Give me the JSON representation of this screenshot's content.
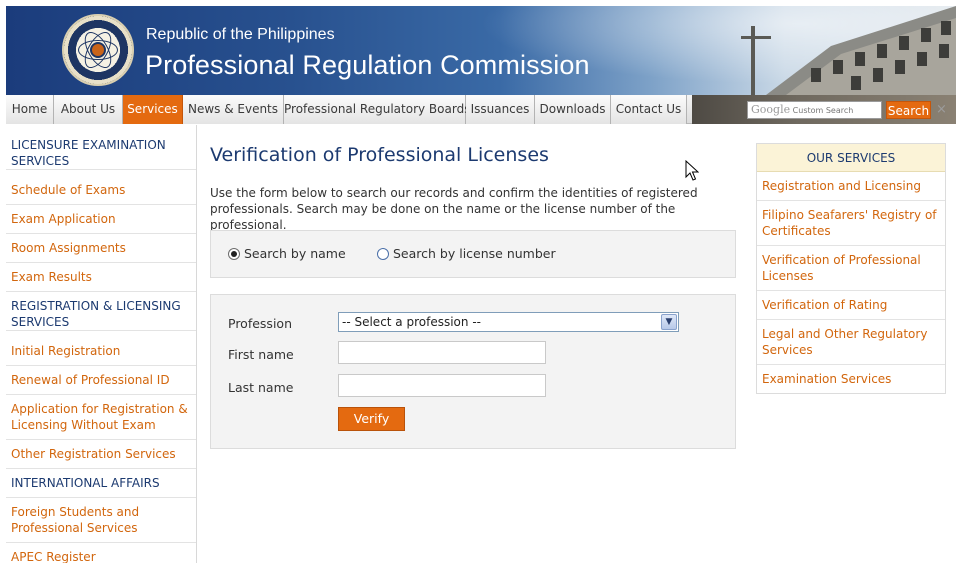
{
  "header": {
    "subtitle": "Republic of the Philippines",
    "title": "Professional Regulation Commission"
  },
  "nav": {
    "tabs": [
      {
        "label": "Home"
      },
      {
        "label": "About Us"
      },
      {
        "label": "Services",
        "active": true
      },
      {
        "label": "News & Events"
      },
      {
        "label": "Professional Regulatory Boards"
      },
      {
        "label": "Issuances"
      },
      {
        "label": "Downloads"
      },
      {
        "label": "Contact Us"
      }
    ],
    "search": {
      "google_label": "Google",
      "placeholder": "Custom Search",
      "button_label": "Search",
      "close_glyph": "×"
    }
  },
  "sidebar": {
    "items": [
      {
        "label": "LICENSURE EXAMINATION SERVICES",
        "type": "head"
      },
      {
        "label": "Schedule of Exams",
        "type": "link"
      },
      {
        "label": "Exam Application",
        "type": "link"
      },
      {
        "label": "Room Assignments",
        "type": "link"
      },
      {
        "label": "Exam Results",
        "type": "link"
      },
      {
        "label": "REGISTRATION & LICENSING SERVICES",
        "type": "head"
      },
      {
        "label": "Initial Registration",
        "type": "link"
      },
      {
        "label": "Renewal of Professional ID",
        "type": "link"
      },
      {
        "label": "Application for Registration & Licensing Without Exam",
        "type": "link"
      },
      {
        "label": "Other Registration Services",
        "type": "link"
      },
      {
        "label": "INTERNATIONAL AFFAIRS",
        "type": "head"
      },
      {
        "label": "Foreign Students and Professional Services",
        "type": "link"
      },
      {
        "label": "APEC Register",
        "type": "link"
      }
    ]
  },
  "main": {
    "title": "Verification of Professional Licenses",
    "intro": "Use the form below to search our records and confirm the identities of registered professionals. Search may be done on the name or the license number of the professional.",
    "search_mode": {
      "by_name": "Search by name",
      "by_license": "Search by license number",
      "selected": "by_name"
    },
    "form": {
      "profession_label": "Profession",
      "profession_value": "-- Select a profession --",
      "first_name_label": "First name",
      "first_name_value": "",
      "last_name_label": "Last name",
      "last_name_value": "",
      "verify_label": "Verify"
    }
  },
  "services": {
    "heading": "OUR SERVICES",
    "items": [
      "Registration and Licensing",
      "Filipino Seafarers' Registry of Certificates",
      "Verification of Professional Licenses",
      "Verification of Rating",
      "Legal and Other Regulatory Services",
      "Examination Services"
    ]
  },
  "colors": {
    "brand_navy": "#1c3a70",
    "accent_orange": "#e46a10",
    "link_orange": "#d2660d"
  }
}
